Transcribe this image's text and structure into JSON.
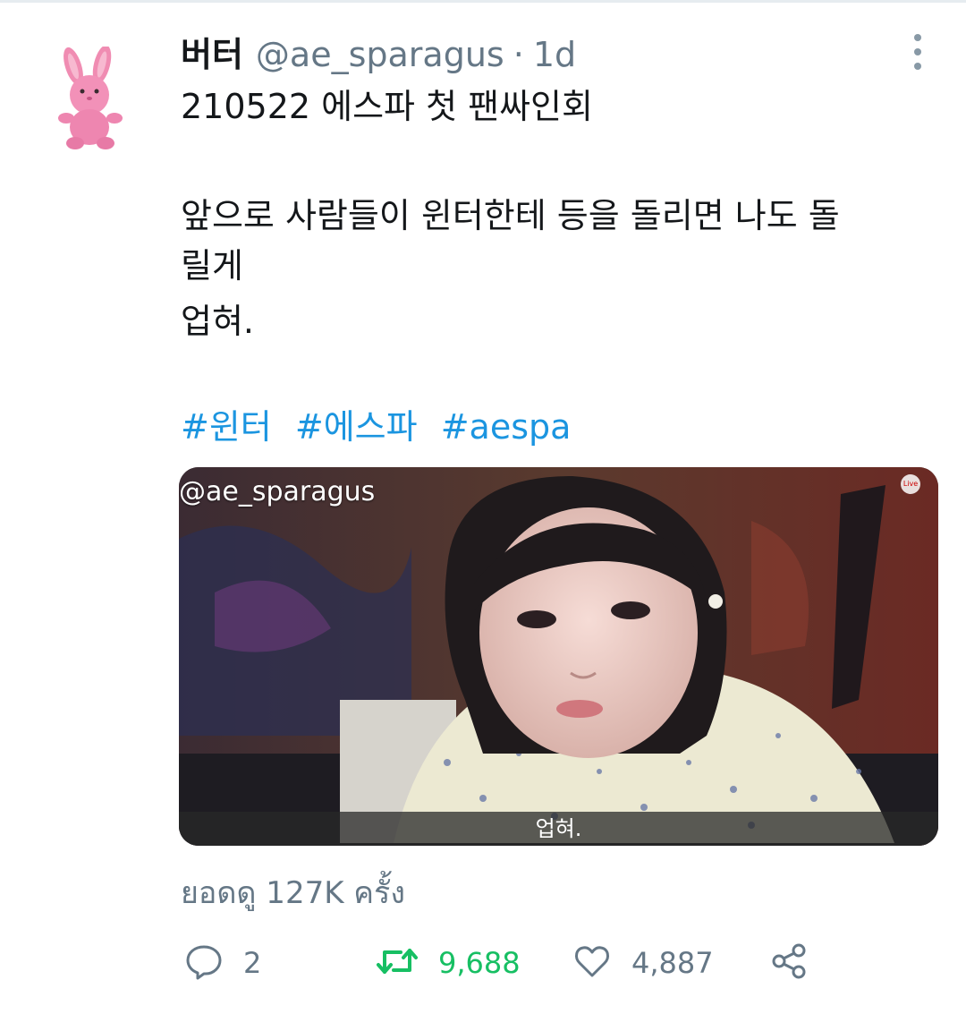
{
  "tweet": {
    "display_name": "버터",
    "handle": "@ae_sparagus",
    "separator": "·",
    "time": "1d",
    "lines": [
      "210522 에스파 첫 팬싸인회",
      "앞으로 사람들이 윈터한테 등을 돌리면 나도 돌",
      "릴게",
      "업혀."
    ],
    "hashtags": [
      "#윈터",
      "#에스파",
      "#aespa"
    ]
  },
  "media": {
    "watermark": "@ae_sparagus",
    "subtitle": "업혀.",
    "badge": "Live"
  },
  "stats": {
    "views_label": "ยอดดู 127K ครั้ง"
  },
  "actions": {
    "reply_count": "2",
    "retweet_count": "9,688",
    "like_count": "4,887"
  },
  "colors": {
    "link": "#1b95e0",
    "retweet": "#17bf63",
    "muted": "#657786"
  },
  "icons": [
    "more-vertical-icon",
    "reply-icon",
    "retweet-icon",
    "like-icon",
    "share-icon"
  ]
}
